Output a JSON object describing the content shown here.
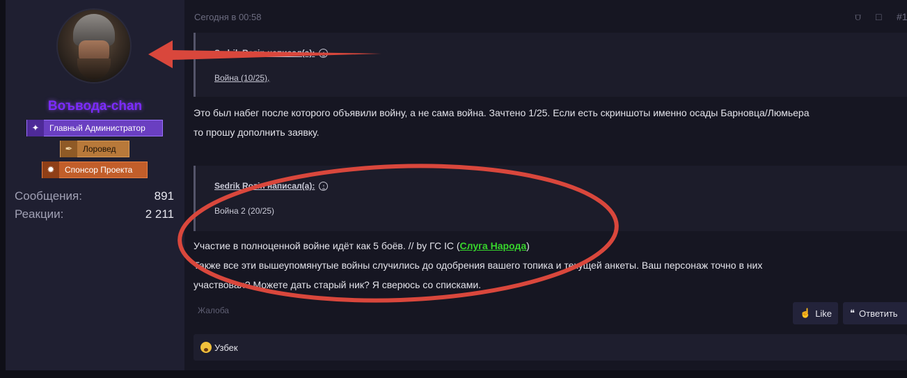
{
  "user": {
    "name": "Воъвода-chan",
    "badges": [
      {
        "label": "Главный Администратор",
        "icon": "flame-icon",
        "color": "#6a3fc1"
      },
      {
        "label": "Лоровед",
        "icon": "quill-icon",
        "color": "#b8793a"
      },
      {
        "label": "Спонсор Проекта",
        "icon": "sparkle-icon",
        "color": "#c25e2a"
      }
    ],
    "stats": [
      {
        "label": "Сообщения:",
        "value": "891"
      },
      {
        "label": "Реакции:",
        "value": "2 211"
      }
    ]
  },
  "post": {
    "date": "Сегодня в 00:58",
    "number": "#1",
    "quotes": [
      {
        "author": "Sedrik Rozin написал(а):",
        "body": "Война (10/25),"
      },
      {
        "author": "Sedrik Rozin написал(а):",
        "body": "Война 2 (20/25)"
      }
    ],
    "paragraph1": {
      "line1": "Это был набег после которого объявили войну, а не сама война. Зачтено 1/25. Если есть скриншоты именно осады Барновца/Люмьера",
      "line2": "то прошу дополнить заявку."
    },
    "paragraph2": {
      "line1_prefix": "Участие в полноценной войне идёт как 5 боёв. // by ГС IC (",
      "line1_link": "Слуга Народа",
      "line1_suffix": ")",
      "line2": "Также все эти вышеупомянутые войны случились до одобрения вашего топика и текущей анкеты. Ваш персонаж точно в них",
      "line3": "участвовал? Можете дать старый ник? Я сверюсь со списками."
    },
    "report_label": "Жалоба",
    "like_label": "Like",
    "reply_label": "Ответить",
    "reaction": {
      "emoji": "flushed-face-icon",
      "text": "Узбек"
    }
  },
  "annotations": {
    "arrow_color": "#d9473c",
    "ellipse_color": "#d9473c"
  }
}
